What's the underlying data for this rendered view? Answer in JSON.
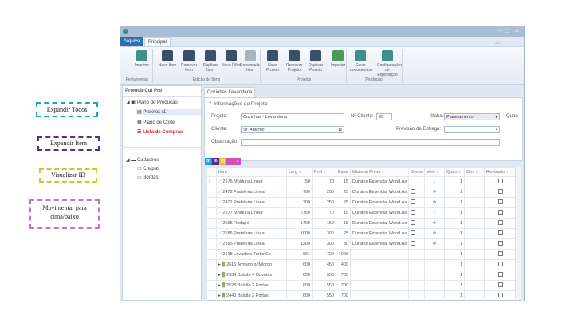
{
  "window": {
    "controls": [
      "—",
      "☐",
      "✕"
    ]
  },
  "ribbon_tabs": [
    {
      "label": "Arquivo",
      "active": true
    },
    {
      "label": "Principal"
    }
  ],
  "ribbon": {
    "buttons": [
      {
        "label": "Imprimir",
        "icon": "printer-icon",
        "color": "#3f8f8a"
      },
      {
        "label": "Novo Item",
        "icon": "box-add-icon",
        "color": "#3a5068"
      },
      {
        "label": "Remover Item",
        "icon": "box-remove-icon",
        "color": "#3a5068"
      },
      {
        "label": "Duplicar Item",
        "icon": "box-duplicate-icon",
        "color": "#3a5068"
      },
      {
        "label": "Novo Filho",
        "icon": "child-add-icon",
        "color": "#3a5068"
      },
      {
        "label": "Desvincular Item",
        "icon": "unlink-icon",
        "color": "#a9b3bd"
      },
      {
        "label": "Novo Projeto",
        "icon": "document-add-icon",
        "color": "#3a5068"
      },
      {
        "label": "Remover Projeto",
        "icon": "document-remove-icon",
        "color": "#3a5068"
      },
      {
        "label": "Duplicar Projeto",
        "icon": "document-duplicate-icon",
        "color": "#3a5068"
      },
      {
        "label": "Importar",
        "icon": "import-icon",
        "color": "#4a9a5a"
      },
      {
        "label": "Gerar documentos",
        "icon": "export-icon",
        "color": "#3f8f8a"
      },
      {
        "label": "Configurações de Exportação",
        "icon": "export-settings-icon",
        "color": "#3f8f8a"
      }
    ],
    "groups": [
      "Ferramentas",
      "Edição de Itens",
      "Projetos",
      "Produção"
    ]
  },
  "sidebar": {
    "title": "Promob Cut Pro",
    "items": [
      "Plano de Produção",
      "Projetos (1)",
      "Plano de Corte",
      "Lista de Compras",
      "Cadastros",
      "Chapas",
      "Bordas"
    ],
    "highlight_color": "#cc2a2a"
  },
  "project_tabs": [
    "Cozinhas",
    "Levanderia"
  ],
  "info": {
    "title": "Informações do Projeto",
    "projeto_label": "Projeto:",
    "projeto": "Cozinhas - Levanderia",
    "ncliente_label": "Nº Cliente:",
    "ncliente": "95",
    "status_label": "Status:",
    "status": "Planejamento",
    "extra": "Quan",
    "cliente_label": "Cliente:",
    "cliente": "Sr. Antônio",
    "previsao_label": "Previsão de Entrega:",
    "previsao": "",
    "obs_label": "Observação:",
    "obs": ""
  },
  "toolbar_colors": [
    "#1aa3c9",
    "#5b2d8a",
    "#e0c020",
    "#d050c0"
  ],
  "grid": {
    "columns": [
      "Item",
      "Larg",
      "Prof",
      "Espe",
      "Material Prima",
      "Borda",
      "Veio",
      "Quan",
      "Obs",
      "Revisado"
    ],
    "rows": [
      [
        "2576 Moldura Linear",
        "50",
        "70",
        "15",
        "Duratex Essencial Wood.As",
        "↔",
        "1"
      ],
      [
        "2472 Prateleira Linear",
        "700",
        "250",
        "25",
        "Duratex Essencial Wood.As",
        "✥",
        "1"
      ],
      [
        "2471 Prateleira Linear",
        "700",
        "250",
        "25",
        "Duratex Essencial Wood.As",
        "✥",
        "1"
      ],
      [
        "2577 Moldura Linear",
        "2750",
        "70",
        "15",
        "Duratex Essencial Wood.As",
        "↕",
        "1"
      ],
      [
        "2595 Rodapé",
        "1400",
        "150",
        "15",
        "Duratex Essencial Wood.As",
        "✥",
        "1"
      ],
      [
        "2586 Prateleira Linear",
        "1000",
        "300",
        "25",
        "Duratex Essencial Wood.As",
        "✥",
        "1"
      ],
      [
        "2595 Prateleira Linear",
        "1200",
        "300",
        "30",
        "Duratex Essencial Wood.As",
        "✥",
        "1"
      ],
      [
        "2618 Lavadora Turbo Ec",
        "661",
        "720",
        "1096",
        "",
        "",
        "1"
      ],
      [
        "2615 Armario p/ Microo",
        "600",
        "450",
        "400",
        "",
        "",
        "1"
      ],
      [
        "2534 Balcão 4 Gavetas",
        "600",
        "550",
        "700",
        "",
        "",
        "1"
      ],
      [
        "2528 Balcão 2 Portas",
        "600",
        "550",
        "700",
        "",
        "",
        "1"
      ],
      [
        "2440 Balcão 2 Portas",
        "600",
        "550",
        "700",
        "",
        "",
        "1"
      ]
    ]
  },
  "annotations": [
    {
      "text": "Expandir Todos",
      "color": "#1aa3c9"
    },
    {
      "text": "Expandir Item",
      "color": "#5b2d8a"
    },
    {
      "text": "Visualizar ID",
      "color": "#e0c020"
    },
    {
      "text": "Movimentar para cima/baixo",
      "color": "#d070c0"
    }
  ]
}
